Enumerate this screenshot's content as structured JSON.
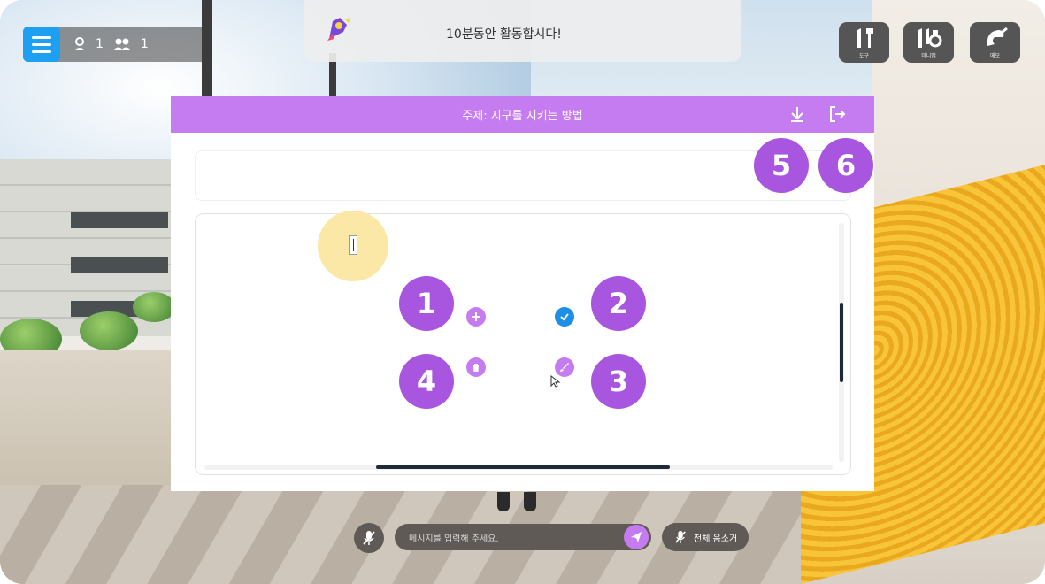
{
  "hud": {
    "users_single_count": "1",
    "users_group_count": "1",
    "menu_icon": "hamburger-menu-icon",
    "user_icon": "person-icon",
    "group_icon": "people-icon"
  },
  "notice": {
    "text": "10분동안 활동합시다!",
    "logo_icon": "rocket-logo-icon"
  },
  "tools": [
    {
      "label": "도구",
      "icon": "tools-icon"
    },
    {
      "label": "미니맵",
      "icon": "minimap-icon"
    },
    {
      "label": "메모",
      "icon": "memo-icon"
    }
  ],
  "panel": {
    "title": "주제: 지구를 지키는 방법",
    "download_icon": "download-icon",
    "exit_icon": "exit-icon",
    "accent": "#c57cf0"
  },
  "node": {
    "add_icon": "plus-icon",
    "confirm_icon": "check-icon",
    "delete_icon": "trash-icon",
    "color_icon": "brush-icon",
    "fill": "#fbe7a6"
  },
  "badges": [
    "1",
    "2",
    "3",
    "4",
    "5",
    "6"
  ],
  "chat": {
    "placeholder": "메시지를 입력해 주세요.",
    "mute_all_label": "전체 음소거",
    "mic_icon": "mic-muted-icon",
    "send_icon": "send-icon"
  }
}
